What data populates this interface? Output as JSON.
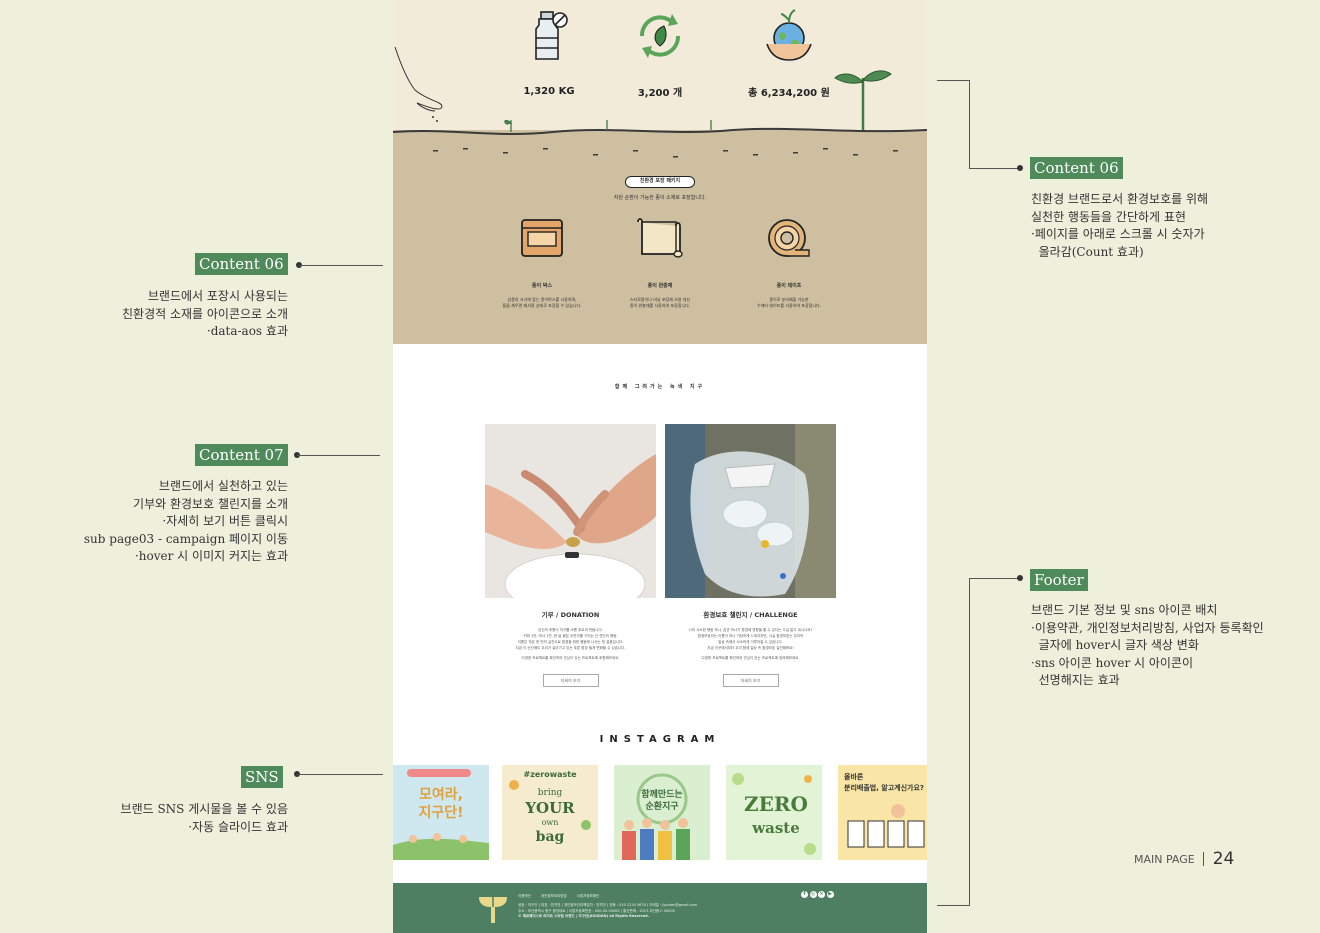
{
  "stats": [
    {
      "icon": "plastic-bottle-icon",
      "value": "1,320 KG"
    },
    {
      "icon": "recycle-icon",
      "value": "3,200 개"
    },
    {
      "icon": "earth-hands-icon",
      "value": "총 6,234,200 원"
    }
  ],
  "packaging": {
    "pill": "친환경 포장 패키지",
    "subtitle": "자원 순환이 가능한 종이 소재로 포장합니다.",
    "items": [
      {
        "icon": "paper-box-icon",
        "title": "종이 박스",
        "desc1": "상품의 크기에 맞는 종이박스를 사용하며,",
        "desc2": "틈을 채우면 재사용 상태로 포장할 수 있습니다."
      },
      {
        "icon": "paper-cushion-icon",
        "title": "종이 완충재",
        "desc1": "스티로폼이나 비닐 포장재 사용 대신",
        "desc2": "종이 완충재를 사용하여 포장합니다."
      },
      {
        "icon": "paper-tape-icon",
        "title": "종이 테이프",
        "desc1": "종이로 분리배출 가능한",
        "desc2": "수에터 테이프를 사용하여 포장합니다."
      }
    ]
  },
  "campaign": {
    "title": "함께 그려가는 녹색 지구",
    "cards": [
      {
        "title": "기부 / DONATION",
        "lines": [
          "당신의 후원이 지구를 아름 푸르게 만듭니다.",
          "커피 1잔, 마사 1잔, 한 달 붉은 우반가를 가지는 긴 연인의 행동,",
          "이름은 작은 한 번의 실천으로 환경을 위한 행동에 나서는 첫 걸음입니다.",
          "지금 이 순간에도 우리가 살아가고 있는 푸른 환경 될게 변화할 수 있습니다.",
          "다양한 프로젝트를 확인하여 관심이 있는 프로젝트에 후원해보세요."
        ],
        "button": "자세히 보기"
      },
      {
        "title": "환경보호 챌린지 / CHALLENGE",
        "lines": [
          "나의 사소한 행동 하나, 습관 하나가 환경에 영향을 줄 수 있다는 사실 알고 계시나요?",
          "환경보호라는 이름이 하나 거창하게 느껴지지만, 사실 환경보호는 우리의",
          "일상 속에서 사소하게 이루어질 수 있습니다.",
          "지금 이곳에서부터 우리 함께 일상 속 환경보호 실천해봐요!",
          "다양한 프로젝트를 확인하여 관심이 있는 프로젝트에 참여해보세요."
        ],
        "button": "자세히 보기"
      }
    ]
  },
  "instagram": {
    "title": "INSTAGRAM",
    "posts": [
      {
        "text1": "모여라,",
        "text2": "지구단!",
        "bg": "#cfe8f0"
      },
      {
        "text1": "#zerowaste",
        "text2": "bring your own bag",
        "bg": "#f4eccd"
      },
      {
        "text1": "함께만드는",
        "text2": "순환지구",
        "bg": "#d9efcf"
      },
      {
        "text1": "ZERO",
        "text2": "waste",
        "bg": "#e3f3d6"
      },
      {
        "text1": "올바른",
        "text2": "분리배출법, 알고계신가요?",
        "bg": "#f9e6a6"
      }
    ]
  },
  "footer": {
    "links": [
      "이용약관",
      "개인정보처리방침",
      "사업자정보확인"
    ],
    "info1": "상호 : 지구단 | 대표 : 민지연 | 개인정보관리책임자 : 민지연 | 전화 : 010 1234 5678 | 이메일 : jigudan@gmail.com",
    "info2": "주소 : 부산광역시 중구 중앙대로 | 사업자등록번호 : 000-00-00000 | 통신판매 : 2023-부산중-F-00000",
    "copyright": "© 제로웨이스트 라이프 스타일 브랜드 | 지구단(JIGUDAN) all Rights Reserved."
  },
  "annotations": {
    "content06_right": {
      "tag": "Content 06",
      "lines": [
        "친환경 브랜드로서 환경보호를 위해",
        "실천한 행동들을 간단하게 표현",
        "·페이지를 아래로 스크롤 시 숫자가",
        "  올라감(Count 효과)"
      ]
    },
    "content06_left": {
      "tag": "Content 06",
      "lines": [
        "브랜드에서 포장시 사용되는",
        "친환경적 소재를 아이콘으로 소개",
        "·data-aos 효과"
      ]
    },
    "content07": {
      "tag": "Content 07",
      "lines": [
        "브랜드에서 실천하고 있는",
        "기부와 환경보호 챌린지를 소개",
        "·자세히 보기 버튼 클릭시",
        "sub page03 - campaign 페이지 이동",
        "·hover 시 이미지 커지는 효과"
      ]
    },
    "sns": {
      "tag": "SNS",
      "lines": [
        "브랜드 SNS 게시물을 볼 수 있음",
        "·자동 슬라이드 효과"
      ]
    },
    "footer": {
      "tag": "Footer",
      "lines": [
        "브랜드 기본 정보 및 sns 아이콘 배치",
        "·이용약관, 개인정보처리방침, 사업자 등록확인",
        "  글자에 hover시 글자 색상 변화",
        "·sns 아이콘 hover 시 아이콘이",
        "  선명해지는 효과"
      ]
    }
  },
  "page_label": "MAIN PAGE",
  "page_number": "24"
}
